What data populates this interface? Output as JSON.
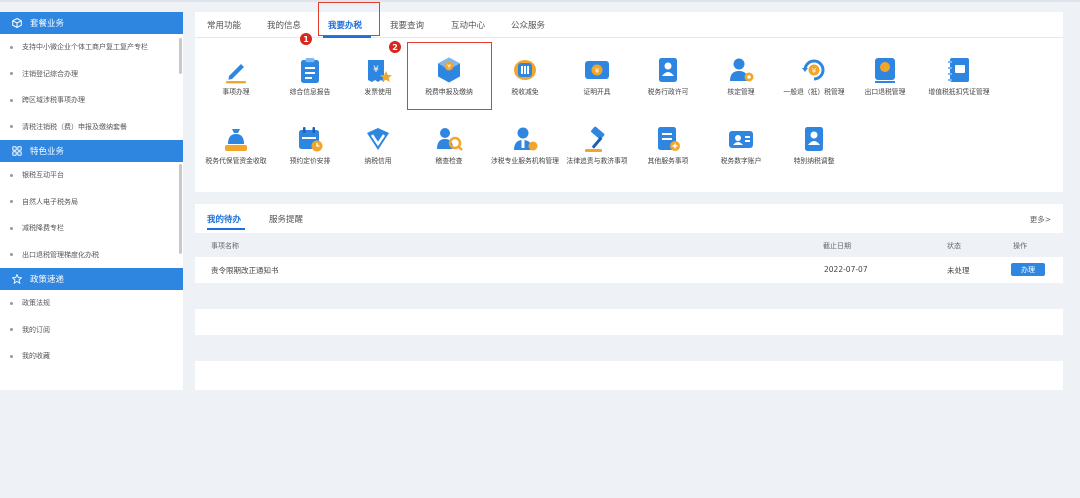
{
  "sidebar": {
    "section1": {
      "title": "套餐业务",
      "icon": "cube-icon"
    },
    "section1_items": [
      "支持中小微企业个体工商户复工复产专栏",
      "注销登记综合办理",
      "跨区域涉税事项办理",
      "清税注销税（费）申报及缴纳套餐"
    ],
    "section2": {
      "title": "特色业务",
      "icon": "grid-icon"
    },
    "section2_items": [
      "银税互动平台",
      "自然人电子税务局",
      "减税降费专栏",
      "出口退税管理梯度化办税"
    ],
    "section3": {
      "title": "政策速递",
      "icon": "star-icon"
    },
    "section3_items": [
      "政策法规",
      "我的订阅",
      "我的收藏"
    ]
  },
  "tabs": [
    "常用功能",
    "我的信息",
    "我要办税",
    "我要查询",
    "互动中心",
    "公众服务"
  ],
  "annotations": {
    "badge1": "1",
    "badge2": "2"
  },
  "services_row1": [
    {
      "label": "事项办理",
      "icon": "pencil-icon"
    },
    {
      "label": "综合信息报告",
      "icon": "clipboard-icon"
    },
    {
      "label": "发票使用",
      "icon": "invoice-icon"
    },
    {
      "label": "税费申报及缴纳",
      "icon": "cube-tax-icon"
    },
    {
      "label": "税收减免",
      "icon": "coins-icon"
    },
    {
      "label": "证明开具",
      "icon": "certificate-icon"
    },
    {
      "label": "税务行政许可",
      "icon": "license-icon"
    },
    {
      "label": "核定管理",
      "icon": "user-gear-icon"
    },
    {
      "label": "一般退（抵）税管理",
      "icon": "refund-icon"
    },
    {
      "label": "出口退税管理",
      "icon": "export-icon"
    },
    {
      "label": "增值税抵扣凭证管理",
      "icon": "notebook-icon"
    }
  ],
  "services_row2": [
    {
      "label": "税务代保管资金收取",
      "icon": "money-bag-icon"
    },
    {
      "label": "预约定价安排",
      "icon": "calendar-icon"
    },
    {
      "label": "纳税信用",
      "icon": "shield-check-icon"
    },
    {
      "label": "稽查检查",
      "icon": "inspect-icon"
    },
    {
      "label": "涉税专业服务机构管理",
      "icon": "agency-icon"
    },
    {
      "label": "法律追责与救济事项",
      "icon": "gavel-icon"
    },
    {
      "label": "其他服务事项",
      "icon": "document-icon"
    },
    {
      "label": "税务数字账户",
      "icon": "account-icon"
    },
    {
      "label": "特别纳税调整",
      "icon": "adjust-icon"
    }
  ],
  "todo": {
    "tabs": [
      "我的待办",
      "服务提醒"
    ],
    "more": "更多>",
    "headers": {
      "name": "事项名称",
      "deadline": "截止日期",
      "status": "状态",
      "action": "操作"
    },
    "rows": [
      {
        "name": "责令限期改正通知书",
        "deadline": "2022-07-07",
        "status": "未处理",
        "action": "办理"
      }
    ]
  },
  "colors": {
    "primary": "#2f86e0",
    "annotation": "#e43d2f"
  }
}
